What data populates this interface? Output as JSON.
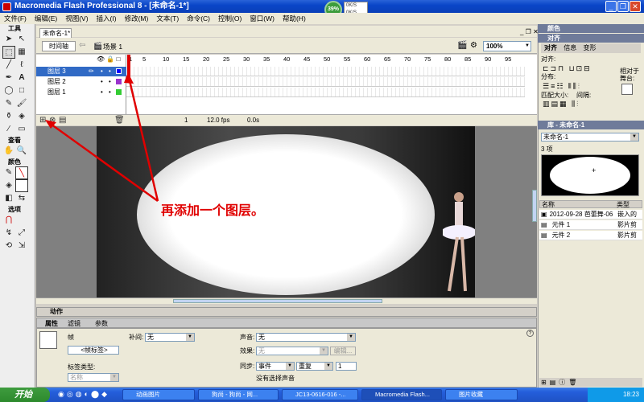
{
  "window": {
    "title": "Macromedia Flash Professional 8 - [未命名-1*]"
  },
  "perf": {
    "percent": "39%",
    "up": "0K/S",
    "down": "0K/S"
  },
  "menu": [
    "文件(F)",
    "编辑(E)",
    "视图(V)",
    "插入(I)",
    "修改(M)",
    "文本(T)",
    "命令(C)",
    "控制(O)",
    "窗口(W)",
    "帮助(H)"
  ],
  "tools": {
    "section_tools": "工具",
    "section_view": "查看",
    "section_colors": "颜色",
    "section_options": "选项"
  },
  "document": {
    "tab": "未命名-1*",
    "timeline_btn": "时间轴",
    "scene": "场景 1",
    "zoom": "100%"
  },
  "timeline": {
    "ruler": [
      "1",
      "5",
      "10",
      "15",
      "20",
      "25",
      "30",
      "35",
      "40",
      "45",
      "50",
      "55",
      "60",
      "65",
      "70",
      "75",
      "80",
      "85",
      "90",
      "95"
    ],
    "layers": [
      {
        "name": "图层 3",
        "color": "#0000ff"
      },
      {
        "name": "图层 2",
        "color": "#9933cc"
      },
      {
        "name": "图层 1",
        "color": "#33cc33"
      }
    ],
    "frame": "1",
    "fps": "12.0 fps",
    "time": "0.0s"
  },
  "annotation": "再添加一个图层。",
  "properties": {
    "actions": "动作",
    "tabs": [
      "属性",
      "滤镜",
      "参数"
    ],
    "frame_label": "帧",
    "frame_label_input": "<帧标签>",
    "label_type": "标签类型:",
    "label_type_value": "名称",
    "tween_label": "补间:",
    "tween_value": "无",
    "sound_label": "声音:",
    "sound_value": "无",
    "effect_label": "效果:",
    "effect_value": "无",
    "edit_btn": "编辑...",
    "sync_label": "同步:",
    "sync_value": "事件",
    "repeat_value": "重复",
    "repeat_count": "1",
    "no_sound": "没有选择声音"
  },
  "right_panel": {
    "color_head": "颜色",
    "align_tabs": [
      "对齐",
      "信息",
      "变形"
    ],
    "align_label": "对齐:",
    "distribute_label": "分布:",
    "match_label": "匹配大小:",
    "spacing_label": "间隔:",
    "relative_stage": "相对于舞台:",
    "library_head": "库 - 未命名-1",
    "library_doc": "未命名-1",
    "item_count": "3 项",
    "col_name": "名称",
    "col_type": "类型",
    "items": [
      {
        "name": "2012-09-28 芭蕾舞-06",
        "type": "嵌入的"
      },
      {
        "name": "元件 1",
        "type": "影片剪"
      },
      {
        "name": "元件 2",
        "type": "影片剪"
      }
    ]
  },
  "taskbar": {
    "start": "开始",
    "tasks": [
      "动画图片",
      "狗尚 - 狗尚 - 网...",
      "JC13-0616-016 -...",
      "Macromedia Flash...",
      "图片收藏"
    ],
    "clock": "18:23"
  }
}
